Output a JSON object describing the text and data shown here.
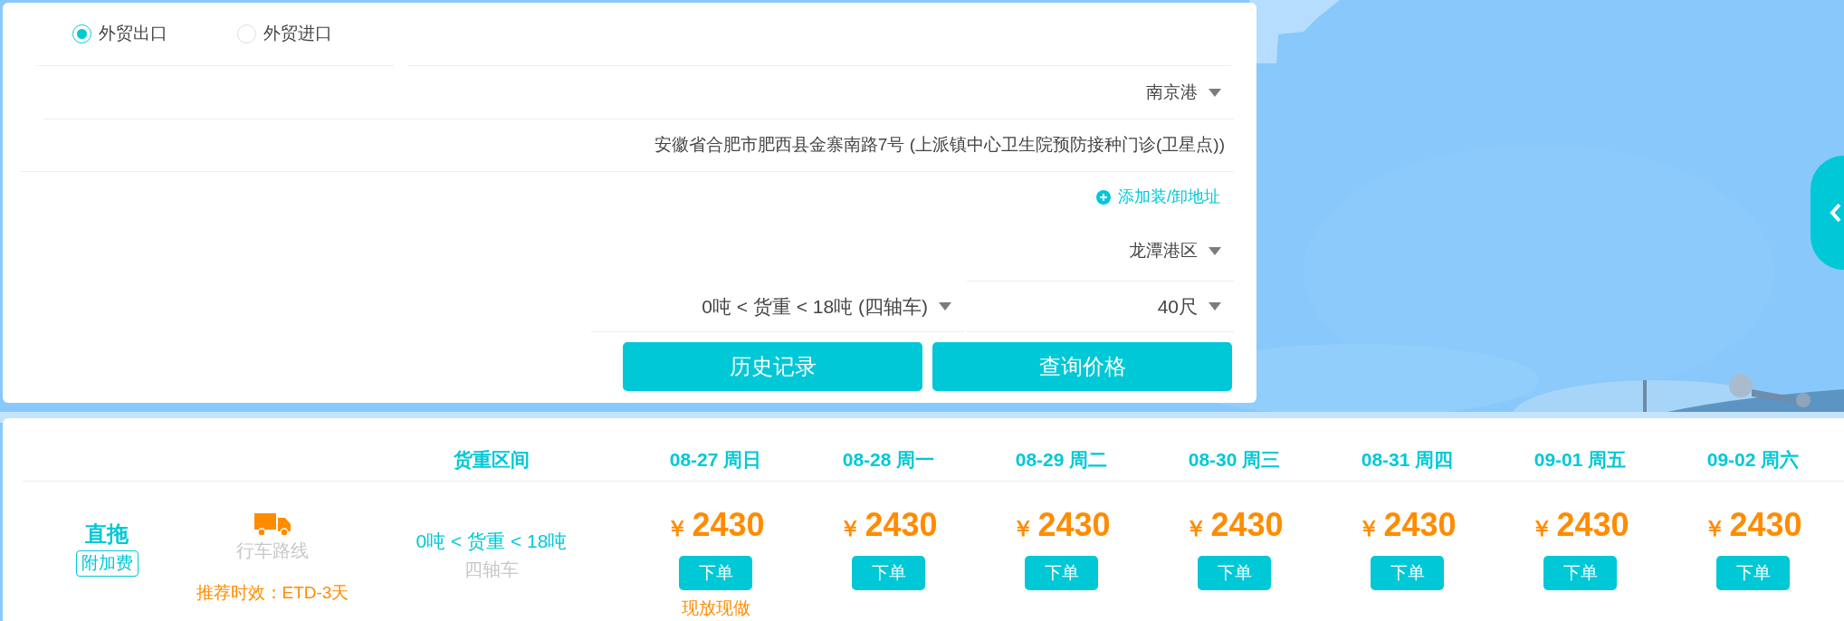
{
  "trade_type": [
    {
      "label": "外贸出口",
      "selected": true
    },
    {
      "label": "外贸进口",
      "selected": false
    }
  ],
  "port": {
    "value": "南京港"
  },
  "address": {
    "value": "安徽省合肥市肥西县金寨南路7号 (上派镇中心卫生院预防接种门诊(卫星点))"
  },
  "add_address_link": "添加装/卸地址",
  "terminal": {
    "value": "龙潭港区"
  },
  "weight_range": {
    "value": "0吨 < 货重 < 18吨 (四轴车)"
  },
  "container_size": {
    "value": "40尺"
  },
  "buttons": [
    "历史记录",
    "查询价格"
  ],
  "results": {
    "columns": [
      "货重区间",
      "08-27 周日",
      "08-28 周一",
      "08-29 周二",
      "08-30 周三",
      "08-31 周四",
      "09-01 周五",
      "09-02 周六"
    ],
    "rows": [
      {
        "service": "直拖",
        "surcharge": "附加费",
        "route": "行车路线",
        "timing": "推荐时效：ETD-3天",
        "weight_range": "0吨 < 货重 < 18吨",
        "vehicle": "四轴车",
        "prices": [
          {
            "currency": "￥",
            "price": "2430",
            "action": "下单",
            "note": "现放现做"
          },
          {
            "currency": "￥",
            "price": "2430",
            "action": "下单"
          },
          {
            "currency": "￥",
            "price": "2430",
            "action": "下单"
          },
          {
            "currency": "￥",
            "price": "2430",
            "action": "下单"
          },
          {
            "currency": "￥",
            "price": "2430",
            "action": "下单"
          },
          {
            "currency": "￥",
            "price": "2430",
            "action": "下单"
          },
          {
            "currency": "￥",
            "price": "2430",
            "action": "下单"
          }
        ]
      }
    ]
  }
}
